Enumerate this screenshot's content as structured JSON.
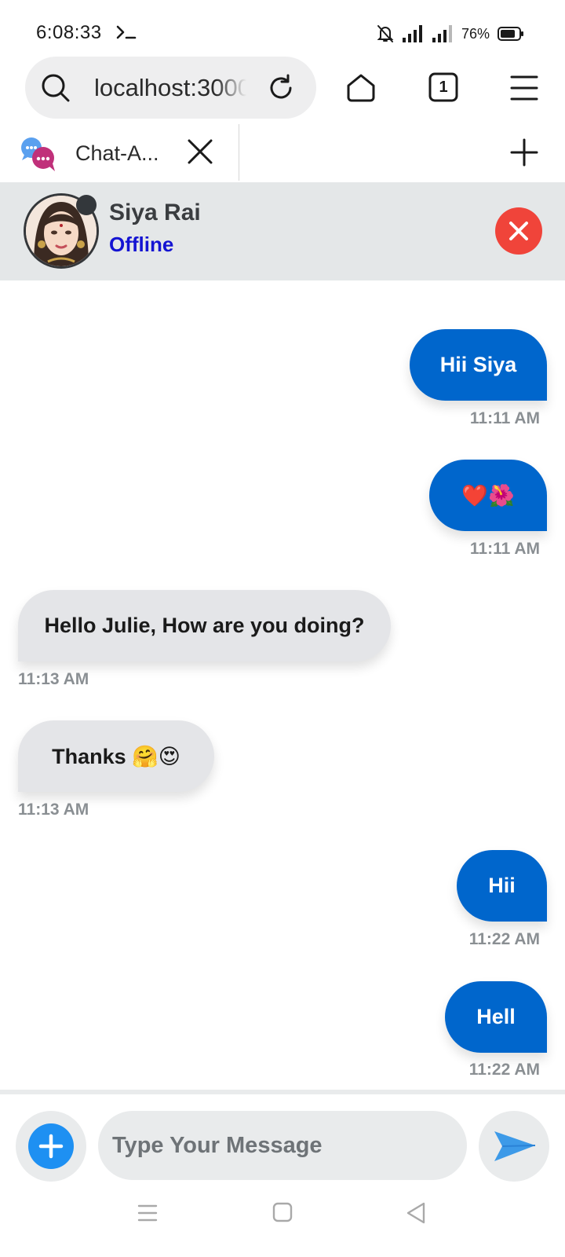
{
  "status_bar": {
    "time": "6:08:33",
    "battery": "76%"
  },
  "browser": {
    "url": "localhost:3000",
    "tab_count": "1",
    "tab_title": "Chat-A..."
  },
  "chat_header": {
    "name": "Siya Rai",
    "status": "Offline",
    "status_color": "#1414d2",
    "close_color": "#f0443a"
  },
  "messages": [
    {
      "direction": "out",
      "text": "Hii Siya",
      "time": "11:11 AM"
    },
    {
      "direction": "out",
      "text": "❤️🌺",
      "time": "11:11 AM"
    },
    {
      "direction": "in",
      "text": "Hello Julie, How are you doing?",
      "time": "11:13 AM"
    },
    {
      "direction": "in",
      "text": "Thanks 🤗😍",
      "time": "11:13 AM"
    },
    {
      "direction": "out",
      "text": "Hii",
      "time": "11:22 AM"
    },
    {
      "direction": "out",
      "text": "Hell",
      "time": "11:22 AM"
    }
  ],
  "composer": {
    "placeholder": "Type Your Message",
    "value": ""
  },
  "colors": {
    "outgoing_bubble": "#0066cc",
    "incoming_bubble": "#e4e5e8",
    "attach_button": "#1e90f2",
    "send_icon": "#3d9ae8"
  },
  "icons": {
    "status_bar": [
      "terminal-icon",
      "mute-icon",
      "signal-icon",
      "battery-icon"
    ],
    "toolbar": [
      "search-icon",
      "reload-icon",
      "home-icon",
      "tabs-icon",
      "menu-icon"
    ],
    "tab": [
      "chat-favicon-icon",
      "close-icon",
      "plus-icon"
    ],
    "composer": [
      "plus-icon",
      "send-icon"
    ],
    "system_nav": [
      "recents-icon",
      "home-icon",
      "back-icon"
    ]
  }
}
